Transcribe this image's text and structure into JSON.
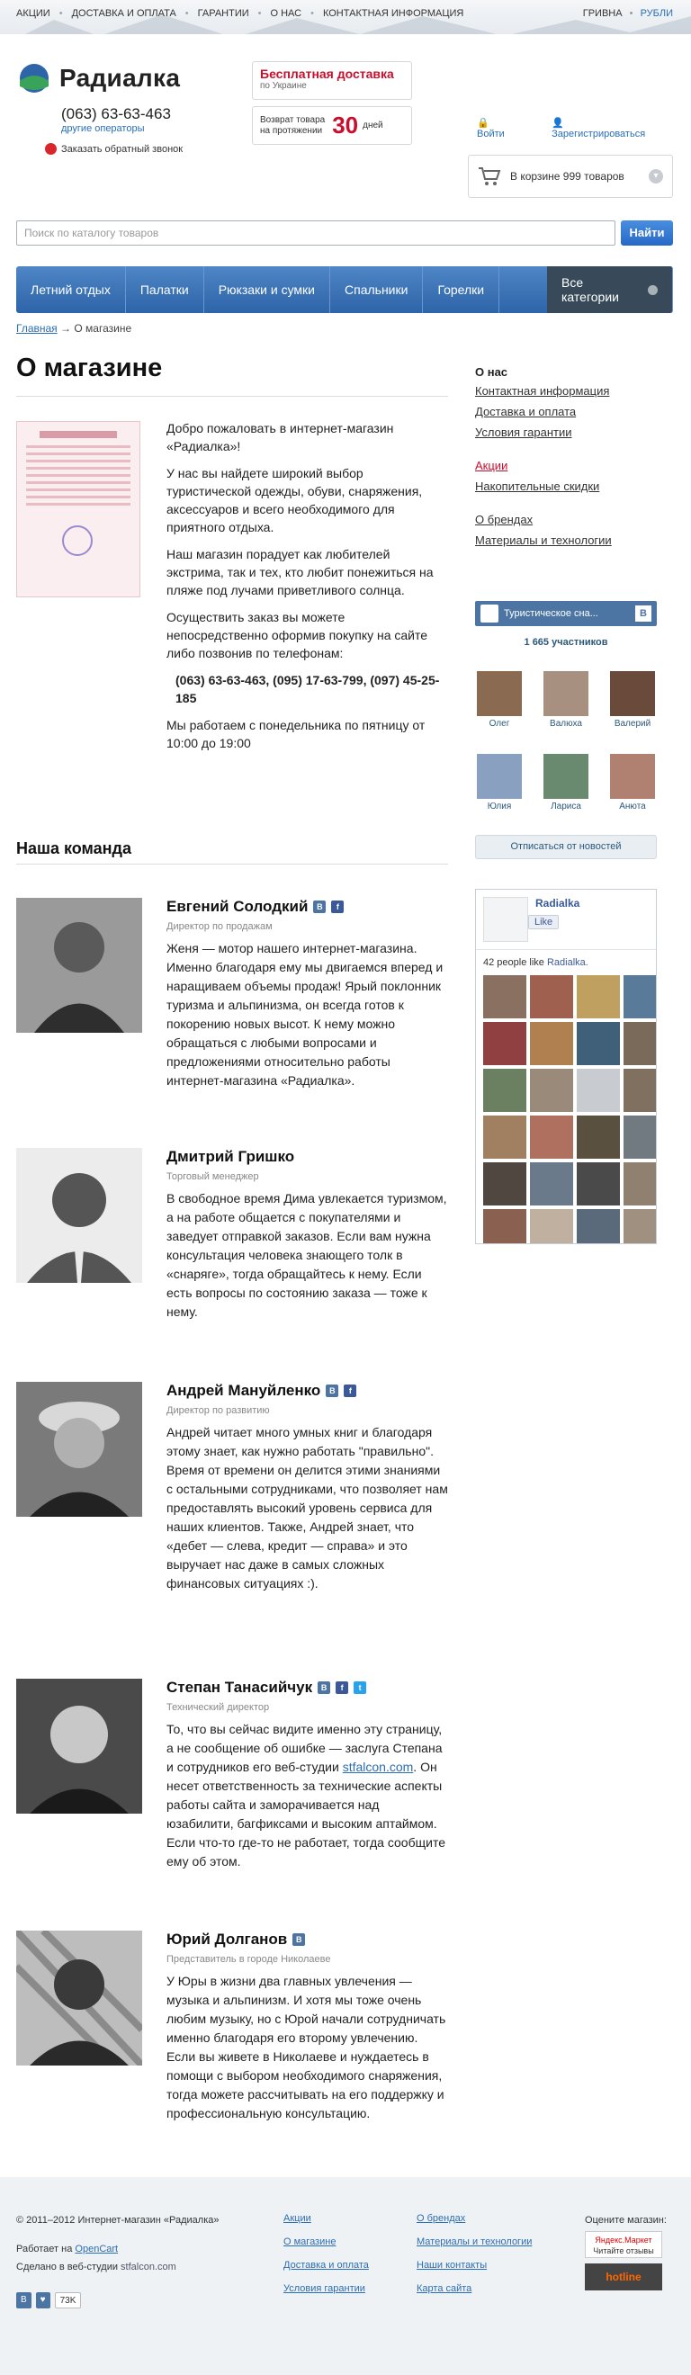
{
  "topnav": {
    "items": [
      "АКЦИИ",
      "ДОСТАВКА И ОПЛАТА",
      "ГАРАНТИИ",
      "О НАС",
      "КОНТАКТНАЯ ИНФОРМАЦИЯ"
    ]
  },
  "currency": {
    "a": "ГРИВНА",
    "sep": "•",
    "b": "РУБЛИ"
  },
  "header": {
    "logo": "Радиалка",
    "phone": "(063) 63-63-463",
    "operators": "другие операторы",
    "callback": "Заказать обратный звонок",
    "free_delivery": "Бесплатная доставка",
    "free_delivery_sub": "по Украине",
    "return_a": "Возврат товара",
    "return_b": "на протяжении",
    "return_n": "30",
    "return_unit": "дней",
    "login": "Войти",
    "register": "Зарегистрироваться",
    "cart": "В корзине 999 товаров"
  },
  "search": {
    "placeholder": "Поиск по каталогу товаров",
    "button": "Найти"
  },
  "nav": {
    "items": [
      "Летний отдых",
      "Палатки",
      "Рюкзаки и сумки",
      "Спальники",
      "Горелки"
    ],
    "all": "Все категории"
  },
  "breadcrumb": {
    "home": "Главная",
    "arrow": "→",
    "current": "О магазине"
  },
  "page": {
    "title": "О магазине",
    "intro": [
      "Добро пожаловать в интернет-магазин «Радиалка»!",
      "У нас вы найдете широкий выбор туристической одежды, обуви, снаряжения, аксессуаров и всего необходимого для приятного отдыха.",
      "Наш магазин порадует как любителей экстрима, так и тех, кто любит понежиться на пляже под лучами приветливого солнца.",
      "Осуществить заказ вы можете непосредственно оформив покупку на сайте либо позвонив по телефонам:"
    ],
    "phones": "(063) 63-63-463, (095) 17-63-799, (097) 45-25-185",
    "hours": "Мы работаем с понедельника по пятницу от 10:00 до 19:00",
    "team_title": "Наша команда"
  },
  "team": [
    {
      "name": "Евгений Солодкий",
      "role": "Директор по продажам",
      "desc": "Женя — мотор нашего интернет-магазина. Именно благодаря ему мы двигаемся вперед и наращиваем объемы продаж! Ярый поклонник туризма и альпинизма, он всегда готов к покорению новых высот. К нему можно обращаться с любыми вопросами и предложениями относительно работы интернет-магазина «Радиалка»."
    },
    {
      "name": "Дмитрий Гришко",
      "role": "Торговый менеджер",
      "desc": "В свободное время Дима увлекается туризмом, а на работе общается с покупателями и заведует отправкой заказов. Если вам нужна консультация человека знающего толк в «снаряге», тогда обращайтесь к нему. Если есть вопросы по состоянию заказа — тоже к нему."
    },
    {
      "name": "Андрей Мануйленко",
      "role": "Директор по развитию",
      "desc": "Андрей читает много умных книг и благодаря этому знает, как нужно работать \"правильно\". Время от времени он делится этими знаниями с остальными сотрудниками, что позволяет нам предоставлять высокий уровень сервиса для наших клиентов. Также, Андрей знает, что «дебет — слева, кредит — справа» и это выручает нас даже в самых сложных финансовых ситуациях :)."
    },
    {
      "name": "Степан Танасийчук",
      "role": "Технический директор",
      "desc_a": "То, что вы сейчас видите именно эту страницу, а не сообщение об ошибке — заслуга Степана и сотрудников его веб-студии ",
      "link": "stfalcon.com",
      "desc_b": ". Он несет ответственность за технические аспекты работы сайта и заморачивается над юзабилити, багфиксами и высоким аптаймом. Если что-то где-то не работает, тогда сообщите ему об этом."
    },
    {
      "name": "Юрий Долганов",
      "role": "Представитель в городе Николаеве",
      "desc": "У Юры в жизни два главных увлечения — музыка и альпинизм. И хотя мы тоже очень любим музыку, но с Юрой начали сотрудничать именно благодаря его второму увлечению. Если вы живете в Николаеве и нуждаетесь в помощи с выбором необходимого снаряжения, тогда можете рассчитывать на его поддержку и профессиональную консультацию."
    }
  ],
  "sidebar": {
    "current": "О нас",
    "links_a": [
      "Контактная информация",
      "Доставка и оплата",
      "Условия гарантии"
    ],
    "links_b": [
      "Акции",
      "Накопительные скидки"
    ],
    "links_c": [
      "О брендах",
      "Материалы и технологии"
    ]
  },
  "vk": {
    "title": "Туристическое сна...",
    "count": "1 665 участников",
    "members_a": [
      "Олег",
      "Валюха",
      "Валерий"
    ],
    "members_b": [
      "Юлия",
      "Лариса",
      "Анюта"
    ],
    "unsubscribe": "Отписаться от новостей"
  },
  "fb": {
    "name": "Radialka",
    "like": "Like",
    "count": "42 people like",
    "page": "Radialka."
  },
  "footer": {
    "copyright": "© 2011–2012 Интернет-магазин «Радиалка»",
    "powered_a": "Работает на",
    "powered_link": "OpenCart",
    "made": "Сделано в веб-студии",
    "studio": "stfalcon.com",
    "col1": [
      "Акции",
      "О магазине",
      "Доставка и оплата",
      "Условия гарантии"
    ],
    "col2": [
      "О брендах",
      "Материалы и технологии",
      "Наши контакты",
      "Карта сайта"
    ],
    "rate": "Оцените магазин:",
    "ym_a": "Яндекс.Маркет",
    "ym_b": "Читайте отзывы",
    "hotline": "hotline",
    "vk_count": "73K"
  },
  "colors": {
    "brand_blue": "#2e64a8",
    "accent_red": "#c8102e",
    "link": "#2a6eb4"
  }
}
